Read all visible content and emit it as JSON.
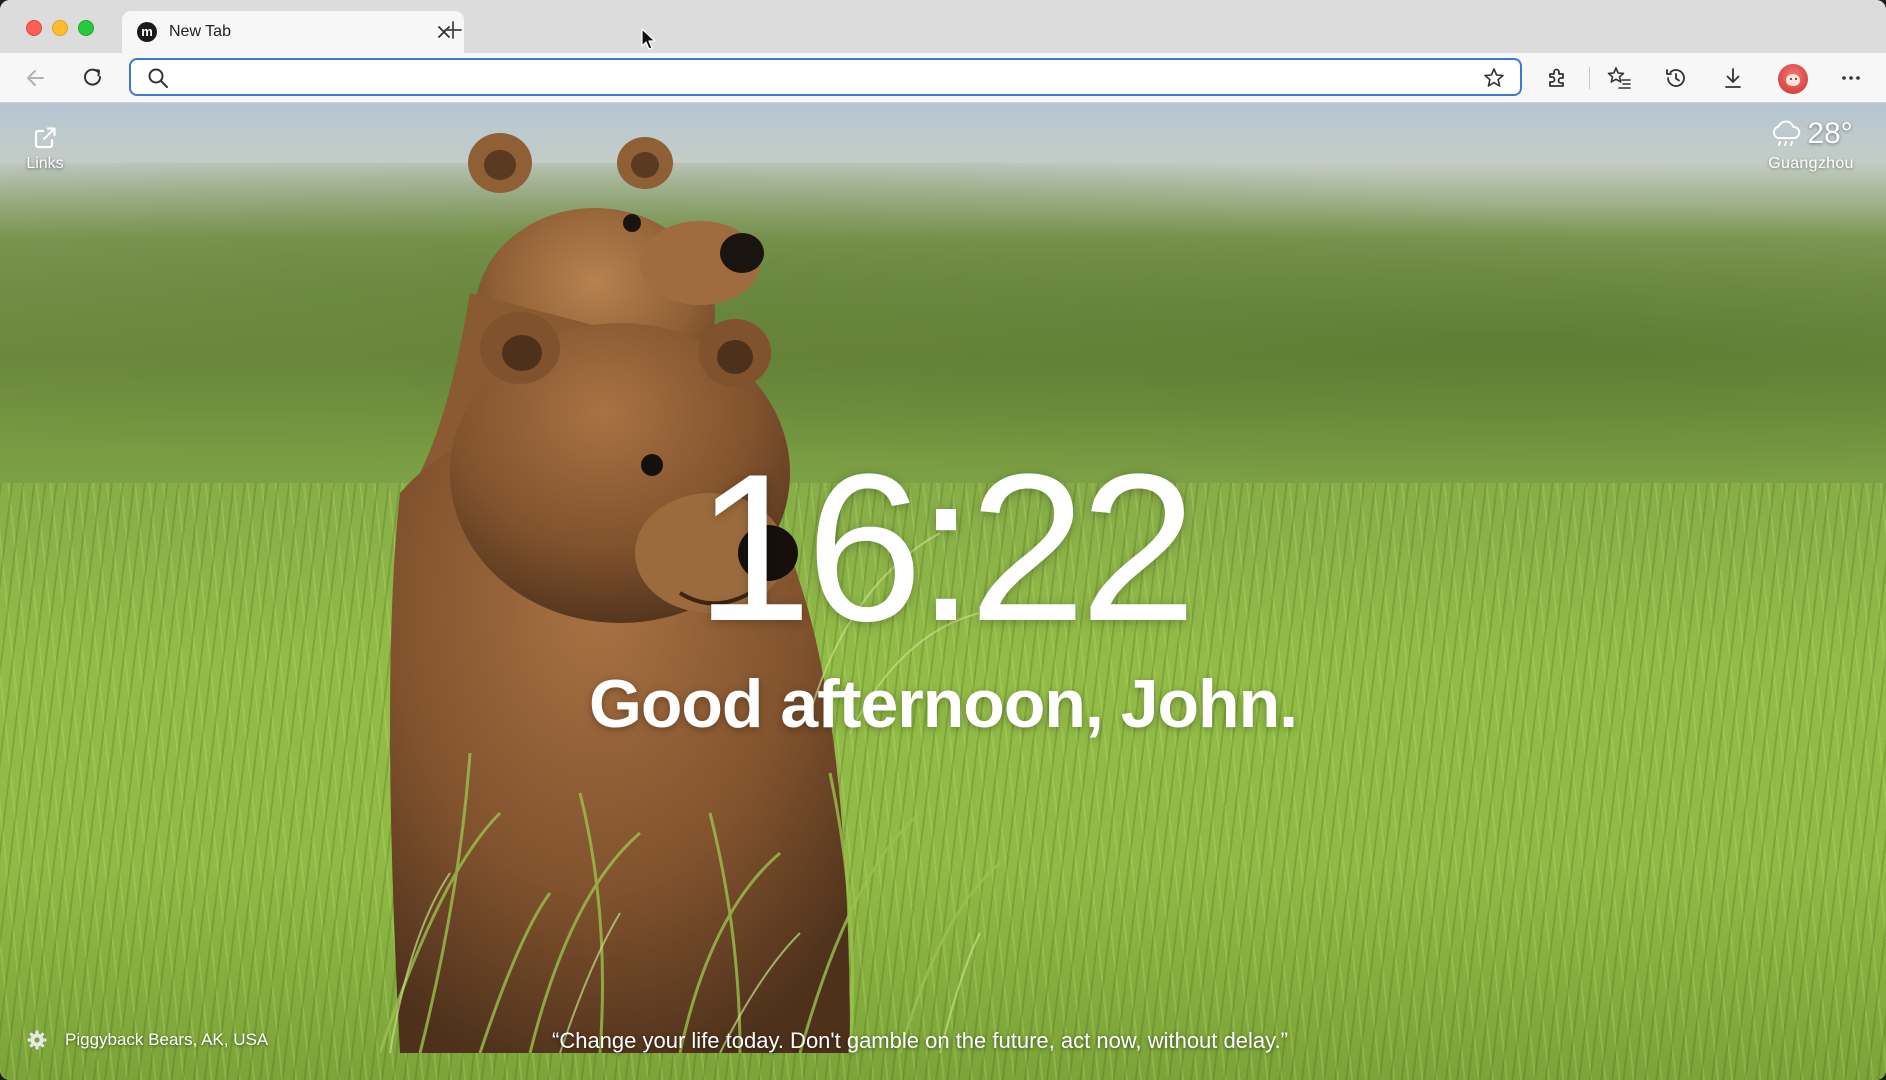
{
  "browser": {
    "tab": {
      "title": "New Tab",
      "favicon_letter": "m"
    },
    "omnibox": {
      "value": "",
      "placeholder": ""
    },
    "icons": {
      "back": "back-arrow-icon",
      "reload": "reload-icon",
      "search": "search-icon",
      "bookmark": "star-icon",
      "extensions": "puzzle-icon",
      "favorites": "favorites-icon",
      "history": "history-icon",
      "downloads": "download-icon",
      "menu": "ellipsis-icon"
    },
    "accent_color": "#3b78d8"
  },
  "newtab": {
    "links_label": "Links",
    "weather": {
      "temperature": "28°",
      "city": "Guangzhou",
      "icon": "cloud-rain-icon"
    },
    "clock": "16:22",
    "greeting": "Good afternoon, John.",
    "photo_credit": "Piggyback Bears, AK, USA",
    "quote": "“Change your life today. Don't gamble on the future, act now, without delay.”"
  }
}
